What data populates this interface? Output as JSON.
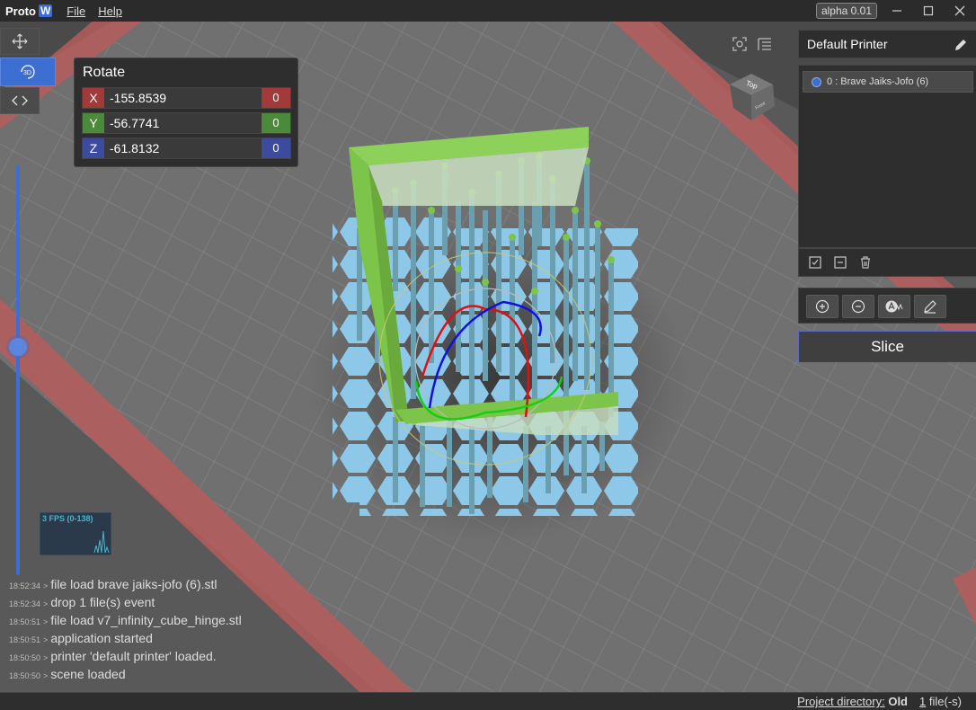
{
  "app": {
    "name": "Proto",
    "badge": "W",
    "version_badge": "alpha 0.01"
  },
  "menu": {
    "file": "File",
    "help": "Help"
  },
  "rotate": {
    "title": "Rotate",
    "axes": [
      {
        "label": "X",
        "value": "-155.8539",
        "reset": "0",
        "color": "#a33a3a"
      },
      {
        "label": "Y",
        "value": "-56.7741",
        "reset": "0",
        "color": "#4a8a3a"
      },
      {
        "label": "Z",
        "value": "-61.8132",
        "reset": "0",
        "color": "#3d4b9e"
      }
    ]
  },
  "tools": {
    "three_d_label": "3D"
  },
  "fps": {
    "label": "3 FPS (0-138)"
  },
  "log": [
    {
      "time": "18:52:34",
      "msg": "file load brave jaiks-jofo (6).stl"
    },
    {
      "time": "18:52:34",
      "msg": "drop 1 file(s) event"
    },
    {
      "time": "18:50:51",
      "msg": "file load v7_infinity_cube_hinge.stl"
    },
    {
      "time": "18:50:51",
      "msg": "application started"
    },
    {
      "time": "18:50:50",
      "msg": "printer 'default printer' loaded."
    },
    {
      "time": "18:50:50",
      "msg": "scene loaded"
    }
  ],
  "viewcube": {
    "top_label": "Top",
    "front_label": "Front"
  },
  "printer": {
    "name": "Default Printer"
  },
  "objects": [
    {
      "label": "0 : Brave Jaiks-Jofo (6)"
    }
  ],
  "slice_label": "Slice",
  "status": {
    "dir_label": "Project directory:",
    "dir_value": "Old",
    "file_count": "1",
    "file_suffix": "file(-s)"
  },
  "icons": [
    "move-icon",
    "rotate-3d-icon",
    "code-icon",
    "focus-icon",
    "list-icon",
    "edit-icon",
    "check-square-icon",
    "minus-square-icon",
    "trash-icon",
    "zoom-in-icon",
    "zoom-out-icon",
    "auto-arrange-icon",
    "pencil-icon"
  ],
  "colors": {
    "accent": "#3c6fd1",
    "model_frame": "#7cc44a",
    "support_base": "#8ec8e8",
    "bed_border": "#b55c5c"
  }
}
